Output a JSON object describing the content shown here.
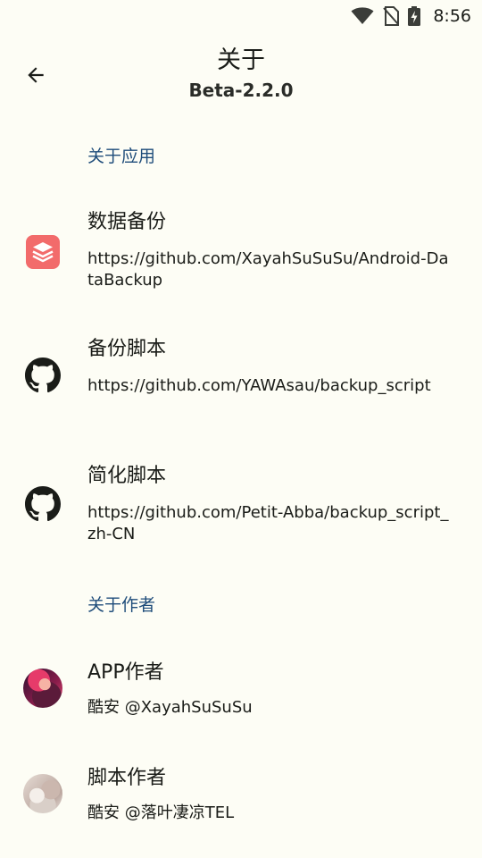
{
  "status_bar": {
    "time": "8:56",
    "icons": [
      "wifi-icon",
      "no-sim-icon",
      "battery-charging-icon"
    ]
  },
  "header": {
    "back_icon": "arrow-back-icon",
    "title": "关于",
    "subtitle": "Beta-2.2.0"
  },
  "sections": {
    "app": {
      "header": "关于应用",
      "items": [
        {
          "icon": "databackup-app-icon",
          "title": "数据备份",
          "desc": "https://github.com/XayahSuSuSu/Android-DataBackup"
        },
        {
          "icon": "github-icon",
          "title": "备份脚本",
          "desc": "https://github.com/YAWAsau/backup_script"
        },
        {
          "icon": "github-icon",
          "title": "简化脚本",
          "desc": "https://github.com/Petit-Abba/backup_script_zh-CN"
        }
      ]
    },
    "author": {
      "header": "关于作者",
      "items": [
        {
          "icon": "avatar",
          "title": "APP作者",
          "desc": "酷安 @XayahSuSuSu"
        },
        {
          "icon": "avatar",
          "title": "脚本作者",
          "desc": "酷安 @落叶凄凉TEL"
        }
      ]
    }
  },
  "colors": {
    "background": "#FDFDF5",
    "accent": "#1E4C7A",
    "app_icon": "#F26B6B"
  }
}
